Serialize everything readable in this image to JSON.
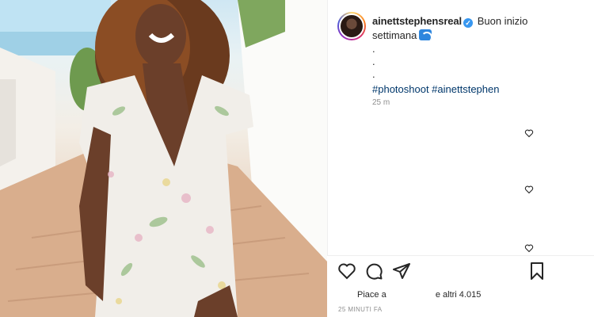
{
  "post": {
    "username": "ainettstephensreal",
    "caption_text": "Buon inizio",
    "caption_line2": "settimana",
    "dots": [
      ".",
      ".",
      "."
    ],
    "hashtags": "#photoshoot #ainettstephens",
    "time_ago": "25 m",
    "likes_prefix": "Piace a",
    "likes_suffix": "e altri 4.015",
    "posted_ago": "25 MINUTI FA"
  },
  "icons": {
    "verified": "verified-badge-icon",
    "emoji": "water-wave-emoji-icon",
    "like": "heart-icon",
    "comment": "comment-icon",
    "share": "paper-plane-icon",
    "save": "bookmark-icon",
    "comment_like": "small-heart-icon"
  },
  "colors": {
    "link": "#00376b",
    "verified": "#3897f0",
    "muted": "#8e8e8e"
  }
}
